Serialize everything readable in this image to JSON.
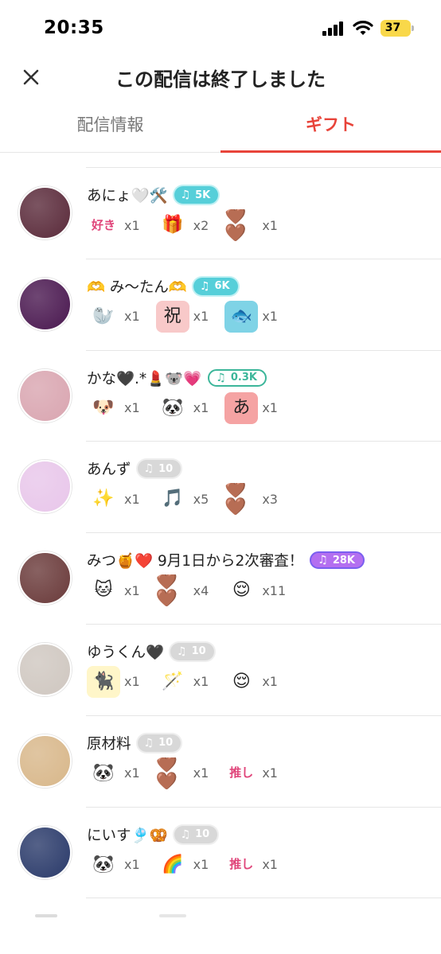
{
  "status_bar": {
    "time": "20:35",
    "battery": "37"
  },
  "header": {
    "title": "この配信は終了しました"
  },
  "tabs": [
    {
      "label": "配信情報",
      "active": false
    },
    {
      "label": "ギフト",
      "active": true
    }
  ],
  "colors": {
    "accent": "#e8443a",
    "badge_teal": "#56cfd9",
    "badge_green": "#3cb69a",
    "badge_gray": "#d8d8d8",
    "badge_purple": "#b46ff0"
  },
  "rows": [
    {
      "name": "あにょ🤍🛠️",
      "badge": "5K",
      "badge_style": "teal",
      "avatar_color": "#5a2a3a",
      "gifts": [
        {
          "icon": "suki-panda-sticker",
          "glyph": "好き",
          "bg": "#ffffff",
          "count": "x1"
        },
        {
          "icon": "present-sticker",
          "glyph": "🎁",
          "bg": "#ffffff",
          "count": "x2"
        },
        {
          "icon": "heart-pair-icon",
          "glyph": "🤎🤎",
          "bg": "#ffffff",
          "count": "x1"
        }
      ]
    },
    {
      "name": "🫶 み〜たん🫶",
      "badge": "6K",
      "badge_style": "teal",
      "avatar_color": "#4a1850",
      "gifts": [
        {
          "icon": "white-seal-sticker",
          "glyph": "🦭",
          "bg": "#ffffff",
          "count": "x1"
        },
        {
          "icon": "iwai-sticker",
          "glyph": "祝",
          "bg": "#f8c9c9",
          "count": "x1"
        },
        {
          "icon": "black-fish-sticker",
          "glyph": "🐟",
          "bg": "#7fd3e6",
          "count": "x1"
        }
      ]
    },
    {
      "name": "かな🖤.*💄🐨💗",
      "badge": "0.3K",
      "badge_style": "green",
      "avatar_color": "#d9a5b0",
      "gifts": [
        {
          "icon": "dog-sticker",
          "glyph": "🐶",
          "bg": "#ffffff",
          "count": "x1"
        },
        {
          "icon": "panda-sticker",
          "glyph": "🐼",
          "bg": "#ffffff",
          "count": "x1"
        },
        {
          "icon": "aguu-sticker",
          "glyph": "あ",
          "bg": "#f5a3a3",
          "count": "x1"
        }
      ]
    },
    {
      "name": "あんず",
      "badge": "10",
      "badge_style": "gray",
      "avatar_color": "#e8c6ea",
      "gifts": [
        {
          "icon": "sparkles-icon",
          "glyph": "✨",
          "bg": "#ffffff",
          "count": "x1"
        },
        {
          "icon": "music-notes-icon",
          "glyph": "🎵",
          "bg": "#ffffff",
          "count": "x5"
        },
        {
          "icon": "heart-pair-icon",
          "glyph": "🤎🤎",
          "bg": "#ffffff",
          "count": "x3"
        }
      ]
    },
    {
      "name": "みつ🍯❤️ 9月1日から2次審査！",
      "badge": "28K",
      "badge_style": "purple",
      "avatar_color": "#6a3a3a",
      "gifts": [
        {
          "icon": "cat-banzai-sticker",
          "glyph": "🐱",
          "bg": "#ffffff",
          "count": "x1"
        },
        {
          "icon": "heart-pair-icon",
          "glyph": "🤎🤎",
          "bg": "#ffffff",
          "count": "x4"
        },
        {
          "icon": "relieved-face-icon",
          "glyph": "😌",
          "bg": "#ffffff",
          "count": "x11"
        }
      ]
    },
    {
      "name": "ゆうくん🖤",
      "badge": "10",
      "badge_style": "gray",
      "avatar_color": "#cfc7c0",
      "gifts": [
        {
          "icon": "black-cat-sticker",
          "glyph": "🐈‍⬛",
          "bg": "#fff6c9",
          "count": "x1"
        },
        {
          "icon": "glow-stick-icon",
          "glyph": "🪄",
          "bg": "#ffffff",
          "count": "x1"
        },
        {
          "icon": "relieved-face-icon",
          "glyph": "😌",
          "bg": "#ffffff",
          "count": "x1"
        }
      ]
    },
    {
      "name": "原材料",
      "badge": "10",
      "badge_style": "gray",
      "avatar_color": "#d8b78a",
      "gifts": [
        {
          "icon": "panda-text-sticker",
          "glyph": "🐼",
          "bg": "#ffffff",
          "count": "x1"
        },
        {
          "icon": "heart-pair-icon",
          "glyph": "🤎🤎",
          "bg": "#ffffff",
          "count": "x1"
        },
        {
          "icon": "oshi-ari-sticker",
          "glyph": "推し",
          "bg": "#ffffff",
          "count": "x1"
        }
      ]
    },
    {
      "name": "にいす🎐🥨",
      "badge": "10",
      "badge_style": "gray",
      "avatar_color": "#2a3a6a",
      "gifts": [
        {
          "icon": "panda-sticker",
          "glyph": "🐼",
          "bg": "#ffffff",
          "count": "x1"
        },
        {
          "icon": "rainbow-icon",
          "glyph": "🌈",
          "bg": "#ffffff",
          "count": "x1"
        },
        {
          "icon": "oshi-omede-sticker",
          "glyph": "推し",
          "bg": "#ffffff",
          "count": "x1"
        }
      ]
    }
  ]
}
